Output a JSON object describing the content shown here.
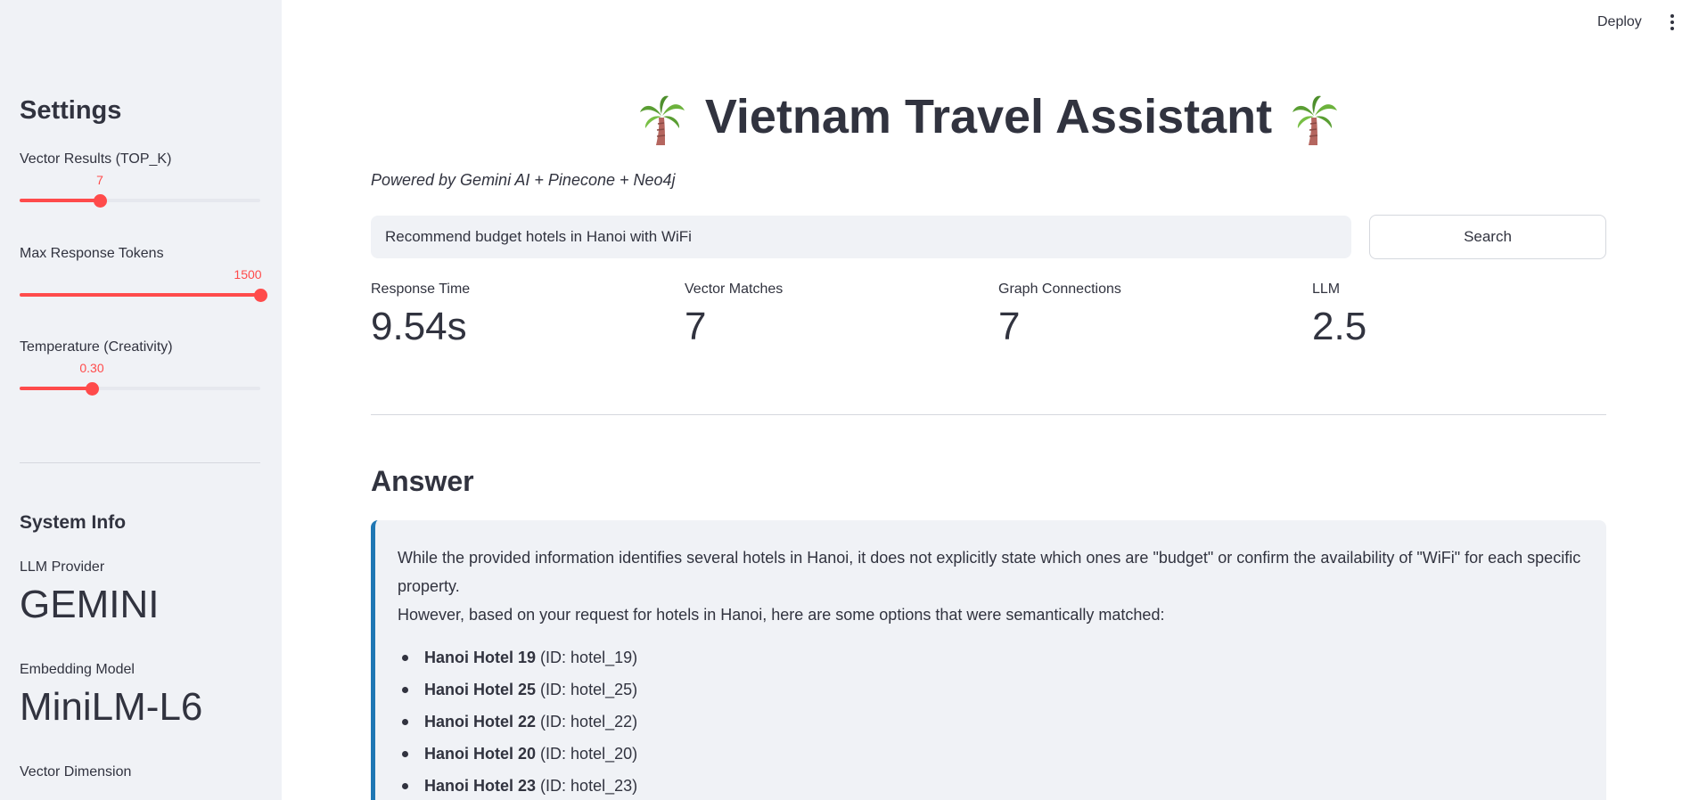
{
  "header": {
    "deploy_label": "Deploy",
    "menu_icon": "kebab-menu-icon"
  },
  "sidebar": {
    "title": "Settings",
    "sliders": [
      {
        "label": "Vector Results (TOP_K)",
        "value": "7",
        "fraction": 0.333
      },
      {
        "label": "Max Response Tokens",
        "value": "1500",
        "fraction": 1.0
      },
      {
        "label": "Temperature (Creativity)",
        "value": "0.30",
        "fraction": 0.3
      }
    ],
    "system_info": {
      "title": "System Info",
      "items": [
        {
          "label": "LLM Provider",
          "value": "GEMINI"
        },
        {
          "label": "Embedding Model",
          "value": "MiniLM-L6"
        },
        {
          "label": "Vector Dimension",
          "value": ""
        }
      ]
    }
  },
  "main": {
    "title": "Vietnam Travel Assistant",
    "title_icon": "palm-tree-icon",
    "subtitle": "Powered by Gemini AI + Pinecone + Neo4j",
    "search": {
      "value": "Recommend budget hotels in Hanoi with WiFi",
      "button_label": "Search"
    },
    "metrics": [
      {
        "label": "Response Time",
        "value": "9.54s"
      },
      {
        "label": "Vector Matches",
        "value": "7"
      },
      {
        "label": "Graph Connections",
        "value": "7"
      },
      {
        "label": "LLM",
        "value": "2.5"
      }
    ],
    "answer": {
      "heading": "Answer",
      "paragraph1": "While the provided information identifies several hotels in Hanoi, it does not explicitly state which ones are \"budget\" or confirm the availability of \"WiFi\" for each specific property.",
      "paragraph2": "However, based on your request for hotels in Hanoi, here are some options that were semantically matched:",
      "items": [
        {
          "name": "Hanoi Hotel 19",
          "id": "(ID: hotel_19)"
        },
        {
          "name": "Hanoi Hotel 25",
          "id": "(ID: hotel_25)"
        },
        {
          "name": "Hanoi Hotel 22",
          "id": "(ID: hotel_22)"
        },
        {
          "name": "Hanoi Hotel 20",
          "id": "(ID: hotel_20)"
        },
        {
          "name": "Hanoi Hotel 23",
          "id": "(ID: hotel_23)"
        }
      ]
    }
  },
  "colors": {
    "accent": "#ff4b4b",
    "sidebar_bg": "#f0f2f6",
    "info_border": "#1f77b4",
    "text": "#31333f"
  }
}
